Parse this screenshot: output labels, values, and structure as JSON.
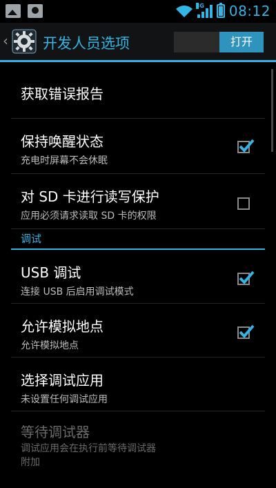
{
  "status_bar": {
    "time": "08:12",
    "network_type": "3G",
    "icons": [
      "image-icon",
      "user-icon",
      "wifi-icon",
      "signal-icon",
      "battery-icon"
    ],
    "accent_color": "#33b5e5"
  },
  "action_bar": {
    "title": "开发人员选项",
    "switch_label": "打开",
    "switch_state": "on"
  },
  "items": [
    {
      "title": "获取错误报告"
    },
    {
      "title": "保持唤醒状态",
      "summary": "充电时屏幕不会休眠",
      "checked": true
    },
    {
      "title": "对 SD 卡进行读写保护",
      "summary": "应用必须请求读取 SD 卡的权限",
      "checked": false
    },
    {
      "section": "调试"
    },
    {
      "title": "USB 调试",
      "summary": "连接 USB 后启用调试模式",
      "checked": true
    },
    {
      "title": "允许模拟地点",
      "summary": "允许模拟地点",
      "checked": true
    },
    {
      "title": "选择调试应用",
      "summary": "未设置任何调试应用"
    },
    {
      "title": "等待调试器",
      "summary": "调试应用会在执行前等待调试器附加",
      "disabled": true
    }
  ]
}
